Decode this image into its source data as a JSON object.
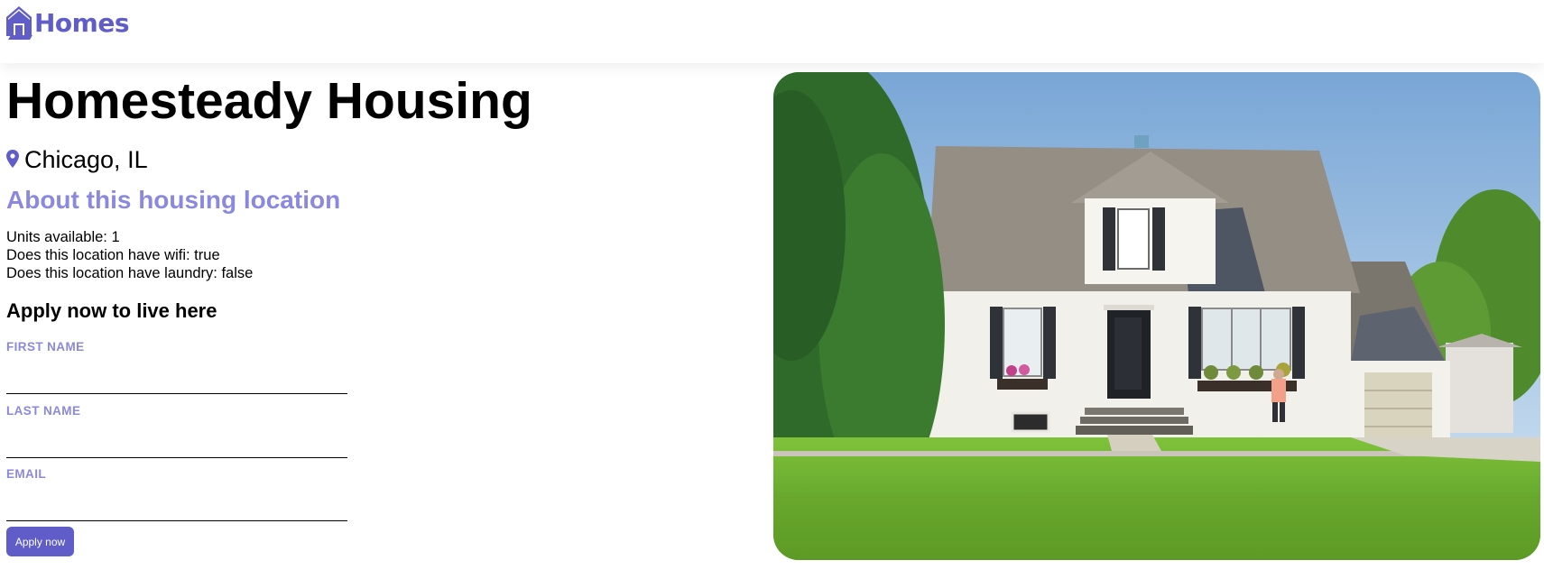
{
  "header": {
    "brand_label": "Homes",
    "brand_icon": "house-icon",
    "brand_color": "#605DC8"
  },
  "listing": {
    "name": "Homesteady Housing",
    "location": "Chicago, IL",
    "location_icon": "map-pin-icon",
    "about_heading": "About this housing location",
    "features": [
      "Units available: 1",
      "Does this location have wifi: true",
      "Does this location have laundry: false"
    ],
    "photo_alt": "Exterior photo of Homesteady Housing"
  },
  "application": {
    "heading": "Apply now to live here",
    "first_name_label": "FIRST NAME",
    "first_name_value": "",
    "last_name_label": "LAST NAME",
    "last_name_value": "",
    "email_label": "EMAIL",
    "email_value": "",
    "submit_label": "Apply now"
  },
  "colors": {
    "accent": "#605DC8",
    "accent_light": "#8B88DF"
  }
}
